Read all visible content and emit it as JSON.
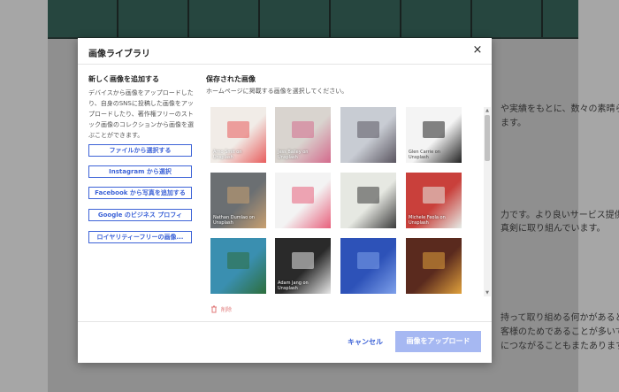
{
  "background": {
    "text_lines": [
      "や実績をもとに、数々の素晴らし",
      "ます。",
      "力です。より良いサービス提供を",
      "真剣に取り組んでいます。",
      "持って取り組める何かがあると思",
      "客様のためであることが多いです",
      "につながることもまたあります。"
    ]
  },
  "modal": {
    "title": "画像ライブラリ",
    "close_label": "×",
    "left": {
      "heading": "新しく画像を追加する",
      "description": "デバイスから画像をアップロードしたり、自身のSNSに投稿した画像をアップロードしたり、著作権フリーのストック画像のコレクションから画像を選ぶことができます。",
      "buttons": [
        "ファイルから選択する",
        "Instagram から選択",
        "Facebook から写真を追加する",
        "Google のビジネス プロフィ",
        "ロイヤリティーフリーの画像..."
      ]
    },
    "right": {
      "heading": "保存された画像",
      "subheading": "ホームページに掲載する画像を選択してください。",
      "images": [
        {
          "caption": "Arno Smit on\nUnsplash",
          "color": "#f1ece7",
          "accent": "#e85d5d",
          "icon": "photo-tile"
        },
        {
          "caption": "Jess Bailey on\nUnsplash",
          "color": "#d9d4cf",
          "accent": "#d46a8c",
          "icon": "photo-tile"
        },
        {
          "caption": "",
          "color": "#c8ccd3",
          "accent": "#5a5560",
          "icon": "photo-tile"
        },
        {
          "caption": "Glen Carrie on\nUnsplash",
          "color": "#f4f4f4",
          "accent": "#222222",
          "icon": "photo-tile",
          "dark": true
        },
        {
          "caption": "Nathan Dumlao on\nUnsplash",
          "color": "#6b6f72",
          "accent": "#c9a071",
          "icon": "photo-tile"
        },
        {
          "caption": "",
          "color": "#f3f3f3",
          "accent": "#e8607c",
          "icon": "photo-tile"
        },
        {
          "caption": "",
          "color": "#e6e8e2",
          "accent": "#3b3b3b",
          "icon": "photo-tile"
        },
        {
          "caption": "Michele Feola on\nUnsplash",
          "color": "#c9403b",
          "accent": "#e5ece7",
          "icon": "photo-tile"
        },
        {
          "caption": "",
          "color": "#3a8fb0",
          "accent": "#2d6e3c",
          "icon": "photo-tile"
        },
        {
          "caption": "Adam Jang on\nUnsplash",
          "color": "#2a2a2a",
          "accent": "#e8e8e8",
          "icon": "photo-tile"
        },
        {
          "caption": "",
          "color": "#2d52b8",
          "accent": "#7ea0ea",
          "icon": "photo-tile"
        },
        {
          "caption": "",
          "color": "#5a2a1e",
          "accent": "#e0a13c",
          "icon": "photo-tile"
        }
      ],
      "delete_label": "削除"
    },
    "footer": {
      "cancel_label": "キャンセル",
      "upload_label": "画像をアップロード"
    }
  },
  "colors": {
    "accent": "#3d63d7",
    "upload_disabled": "#a6b8f2",
    "delete": "#e07a7a"
  }
}
